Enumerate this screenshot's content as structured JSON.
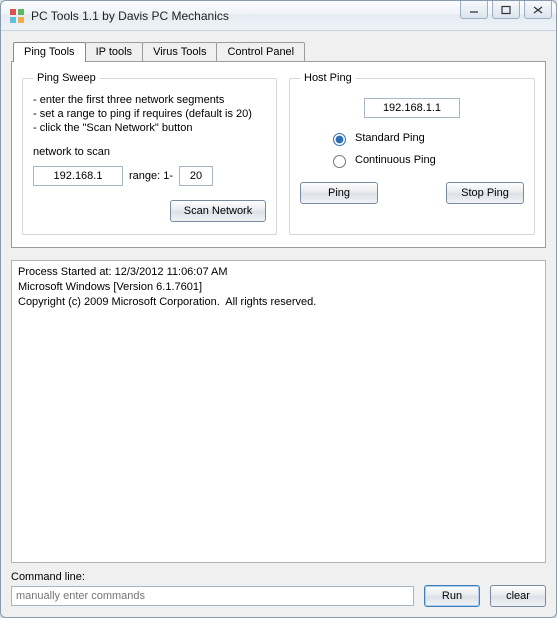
{
  "window": {
    "title": "PC Tools 1.1 by Davis PC Mechanics"
  },
  "tabs": [
    {
      "label": "Ping Tools"
    },
    {
      "label": "IP tools"
    },
    {
      "label": "Virus Tools"
    },
    {
      "label": "Control Panel"
    }
  ],
  "ping_sweep": {
    "legend": "Ping Sweep",
    "instructions": [
      "- enter the first three network segments",
      "- set a range to ping if requires (default is 20)",
      "- click the \"Scan Network\" button"
    ],
    "network_label": "network to scan",
    "network_value": "192.168.1",
    "range_label": "range:  1-",
    "range_value": "20",
    "scan_button": "Scan Network"
  },
  "host_ping": {
    "legend": "Host Ping",
    "host_value": "192.168.1.1",
    "standard": "Standard Ping",
    "continuous": "Continuous Ping",
    "ping_button": "Ping",
    "stop_button": "Stop Ping"
  },
  "output": "Process Started at: 12/3/2012 11:06:07 AM\nMicrosoft Windows [Version 6.1.7601]\nCopyright (c) 2009 Microsoft Corporation.  All rights reserved.",
  "command": {
    "label": "Command line:",
    "placeholder": "manually enter commands",
    "run": "Run",
    "clear": "clear"
  }
}
